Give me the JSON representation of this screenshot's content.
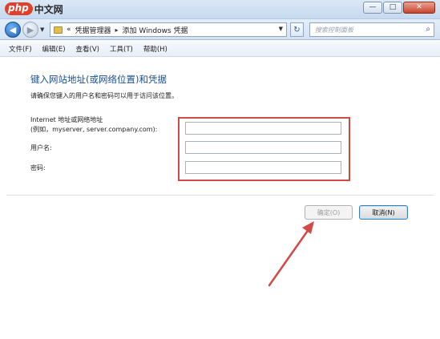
{
  "watermark": {
    "brand": "php",
    "site": "中文网"
  },
  "window": {
    "minimize": "—",
    "maximize": "□",
    "close": "✕"
  },
  "address": {
    "overflow": "«",
    "crumb1": "凭据管理器",
    "crumb_sep": "▸",
    "crumb2": "添加 Windows 凭据",
    "search_placeholder": "搜索控制面板"
  },
  "menu": [
    "文件(F)",
    "编辑(E)",
    "查看(V)",
    "工具(T)",
    "帮助(H)"
  ],
  "form": {
    "heading": "键入网站地址(或网络位置)和凭据",
    "subtitle": "请确保您键入的用户名和密码可以用于访问该位置。",
    "internet_label": "Internet 地址或网络地址",
    "internet_example": "(例如，myserver, server.company.com):",
    "user_label": "用户名:",
    "pass_label": "密码:",
    "internet_value": "",
    "user_value": "",
    "pass_value": ""
  },
  "buttons": {
    "ok": "确定(O)",
    "cancel": "取消(N)"
  },
  "colors": {
    "accent": "#1c4f8f",
    "highlight": "#d14a46"
  }
}
